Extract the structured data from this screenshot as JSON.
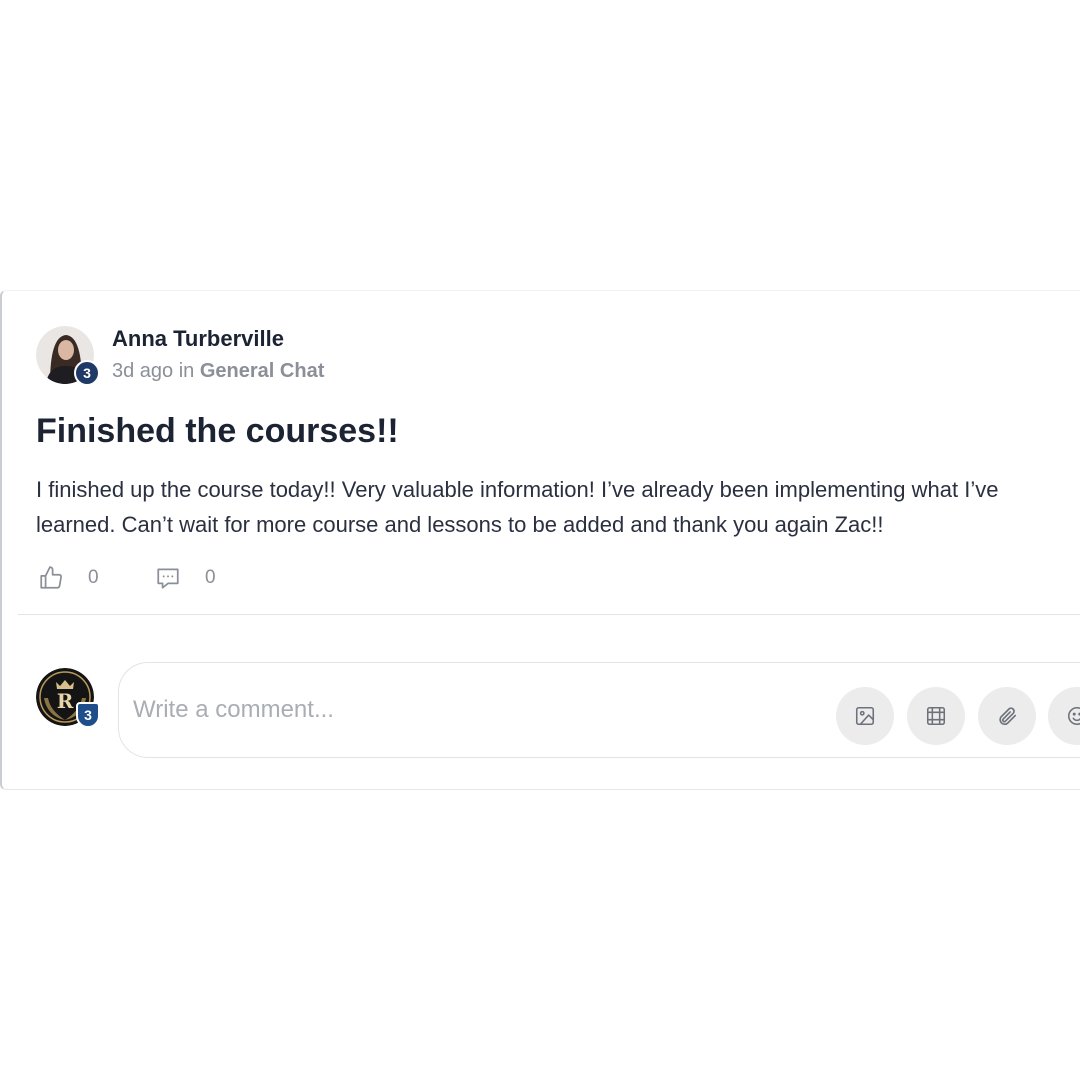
{
  "post": {
    "author": "Anna Turberville",
    "author_level": "3",
    "time_ago": "3d ago",
    "in_word": "in",
    "channel": "General Chat",
    "title": "Finished the courses!!",
    "body": "I finished up the course today!! Very valuable information! I’ve already been implementing what I’ve learned. Can’t wait for more course and lessons to be added and thank you again Zac!!",
    "likes": "0",
    "comments": "0"
  },
  "composer": {
    "user_level": "3",
    "placeholder": "Write a comment...",
    "tools": [
      "image-icon",
      "gif-icon",
      "paperclip-icon",
      "emoji-icon"
    ]
  },
  "colors": {
    "level_badge": "#1f3a66",
    "text_primary": "#1c2434",
    "text_muted": "#8a8f98",
    "tool_bg": "#ececed"
  }
}
